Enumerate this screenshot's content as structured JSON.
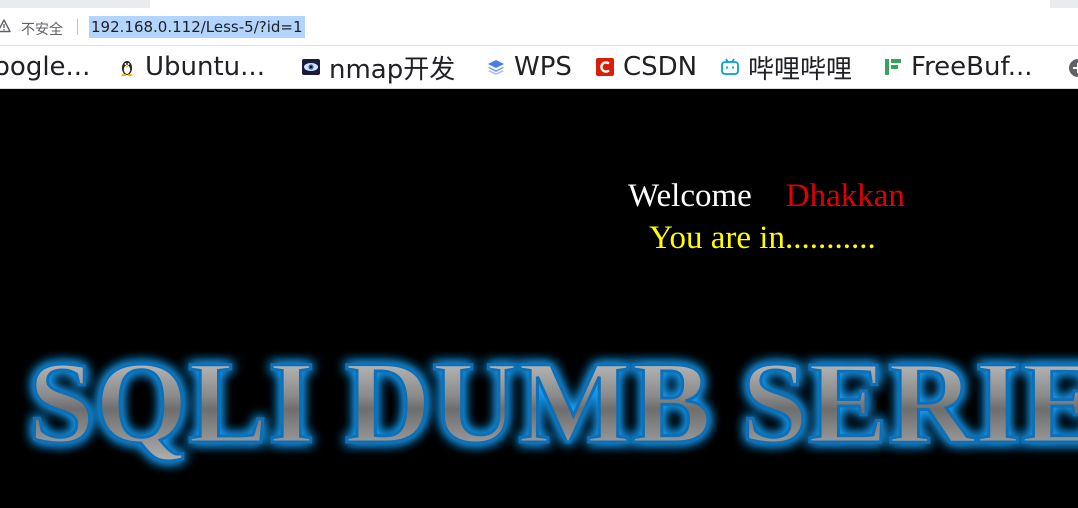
{
  "browser": {
    "insecure_label": "不安全",
    "url": "192.168.0.112/Less-5/?id=1"
  },
  "bookmarks": [
    {
      "label": "oogle...",
      "icon": "google-icon"
    },
    {
      "label": "Ubuntu...",
      "icon": "tux-penguin-icon"
    },
    {
      "label": "nmap开发",
      "icon": "nmap-eye-icon"
    },
    {
      "label": "WPS",
      "icon": "wps-layers-icon"
    },
    {
      "label": "CSDN",
      "icon": "csdn-icon"
    },
    {
      "label": "哔哩哔哩",
      "icon": "bilibili-tv-icon"
    },
    {
      "label": "FreeBuf...",
      "icon": "freebuf-icon"
    }
  ],
  "page": {
    "welcome": "Welcome",
    "username": "Dhakkan",
    "status": "You are in...........",
    "banner_text": "SQLI DUMB SERIES"
  },
  "colors": {
    "page_bg": "#000000",
    "welcome": "#ffffff",
    "username": "#e00000",
    "status": "#ffff00",
    "banner_glow": "#1aa3ff",
    "url_highlight": "#b3d4fc"
  }
}
